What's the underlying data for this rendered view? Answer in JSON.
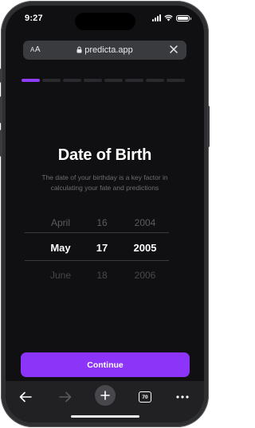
{
  "status_bar": {
    "time": "9:27"
  },
  "browser": {
    "text_size_label_small": "A",
    "text_size_label_large": "A",
    "url": "predicta.app",
    "tab_count": "70"
  },
  "onboarding": {
    "progress": {
      "total_steps": 8,
      "current_step": 1
    },
    "title": "Date of Birth",
    "subtitle": "The date of your birthday is a key factor in calculating your fate and predictions",
    "picker": {
      "months": [
        "April",
        "May",
        "June"
      ],
      "days": [
        "16",
        "17",
        "18"
      ],
      "years": [
        "2004",
        "2005",
        "2006"
      ],
      "selected": {
        "month": "May",
        "day": "17",
        "year": "2005"
      }
    },
    "continue_label": "Continue"
  },
  "colors": {
    "accent": "#8d34f9",
    "background": "#101012"
  }
}
